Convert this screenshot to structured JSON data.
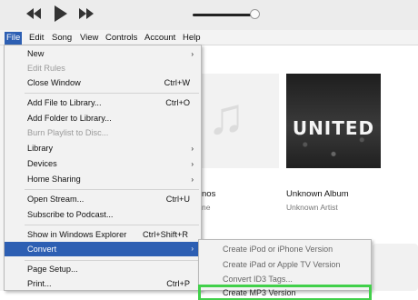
{
  "menubar": {
    "items": [
      "File",
      "Edit",
      "Song",
      "View",
      "Controls",
      "Account",
      "Help"
    ],
    "active": "File"
  },
  "file_menu": {
    "items": [
      {
        "label": "New",
        "shortcut": "",
        "arrow": "›",
        "disabled": false
      },
      {
        "label": "Edit Rules",
        "shortcut": "",
        "arrow": "",
        "disabled": true
      },
      {
        "label": "Close Window",
        "shortcut": "Ctrl+W",
        "arrow": "",
        "disabled": false
      },
      {
        "label": "Add File to Library...",
        "shortcut": "Ctrl+O",
        "arrow": "",
        "disabled": false
      },
      {
        "label": "Add Folder to Library...",
        "shortcut": "",
        "arrow": "",
        "disabled": false
      },
      {
        "label": "Burn Playlist to Disc...",
        "shortcut": "",
        "arrow": "",
        "disabled": true
      },
      {
        "label": "Library",
        "shortcut": "",
        "arrow": "›",
        "disabled": false
      },
      {
        "label": "Devices",
        "shortcut": "",
        "arrow": "›",
        "disabled": false
      },
      {
        "label": "Home Sharing",
        "shortcut": "",
        "arrow": "›",
        "disabled": false
      },
      {
        "label": "Open Stream...",
        "shortcut": "Ctrl+U",
        "arrow": "",
        "disabled": false
      },
      {
        "label": "Subscribe to Podcast...",
        "shortcut": "",
        "arrow": "",
        "disabled": false
      },
      {
        "label": "Show in Windows Explorer",
        "shortcut": "Ctrl+Shift+R",
        "arrow": "",
        "disabled": false
      },
      {
        "label": "Convert",
        "shortcut": "",
        "arrow": "›",
        "disabled": false
      },
      {
        "label": "Page Setup...",
        "shortcut": "",
        "arrow": "",
        "disabled": false
      },
      {
        "label": "Print...",
        "shortcut": "Ctrl+P",
        "arrow": "",
        "disabled": false
      }
    ]
  },
  "convert_submenu": {
    "items": [
      {
        "label": "Create iPod or iPhone Version"
      },
      {
        "label": "Create iPad or Apple TV Version"
      },
      {
        "label": "Convert ID3 Tags..."
      },
      {
        "label": "Create MP3 Version"
      }
    ]
  },
  "library": {
    "album": {
      "title": "Unknown Album",
      "artist": "Unknown Artist",
      "cover_text": "UNITED"
    },
    "partial_title": "nos",
    "partial_artist": "ne"
  },
  "colors": {
    "menu_highlight": "#2d5fb3",
    "selection_outline": "#41d04a"
  }
}
